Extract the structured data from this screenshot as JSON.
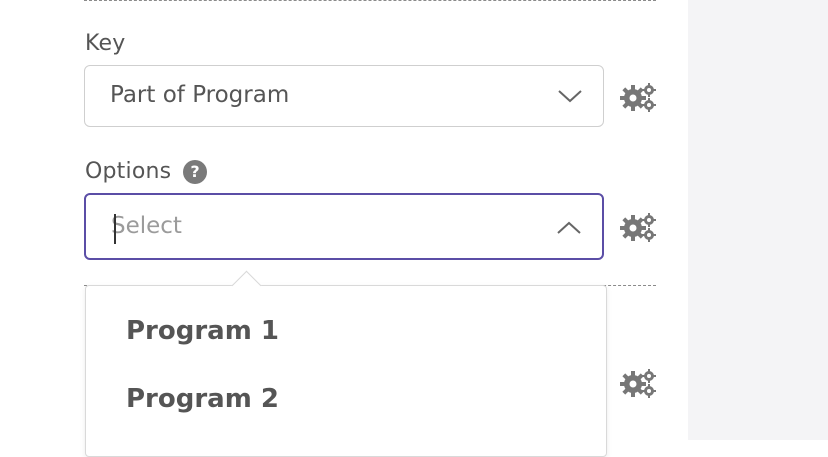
{
  "key_field": {
    "label": "Key",
    "selected_value": "Part of Program"
  },
  "options_field": {
    "label": "Options",
    "placeholder": "Select",
    "help_icon": "question-circle-icon"
  },
  "dropdown": {
    "options": [
      "Program 1",
      "Program 2"
    ]
  },
  "icons": {
    "settings": "gears-icon",
    "chevron_down": "chevron-down-icon",
    "chevron_up": "chevron-up-icon"
  },
  "colors": {
    "focus_border": "#5b4ea6",
    "icon_gray": "#777777"
  }
}
